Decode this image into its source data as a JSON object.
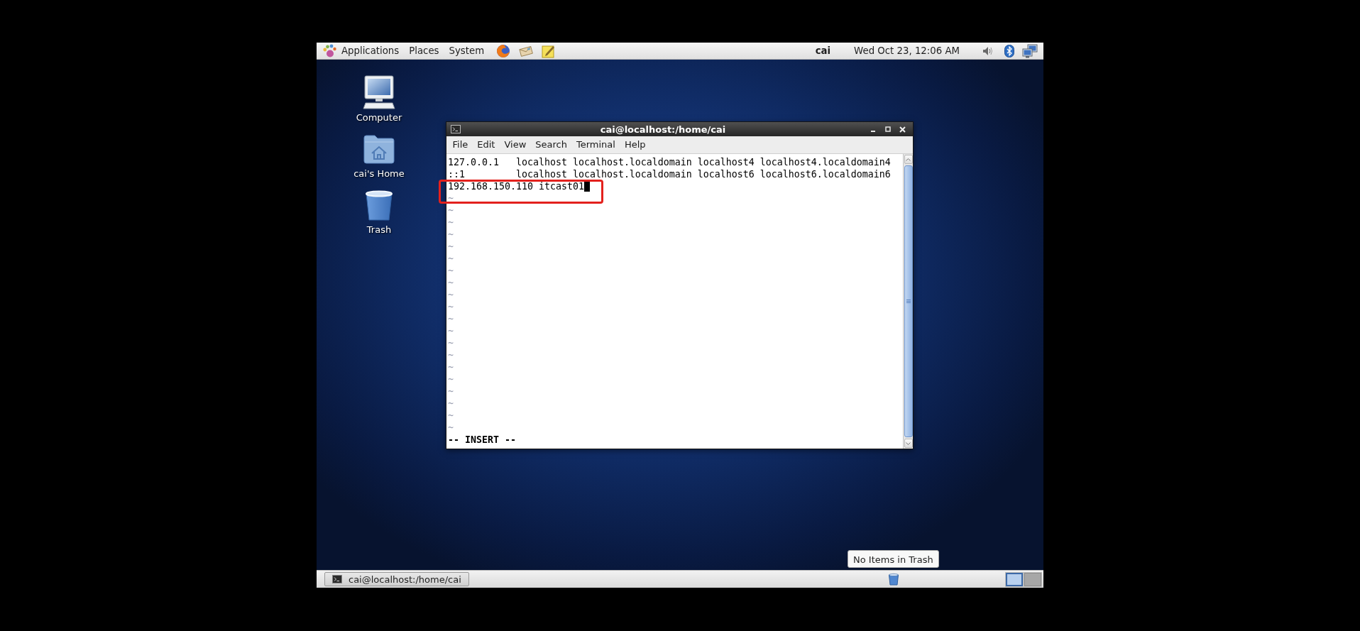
{
  "top_panel": {
    "menus": [
      "Applications",
      "Places",
      "System"
    ],
    "user": "cai",
    "clock": "Wed Oct 23, 12:06 AM"
  },
  "desktop_icons": [
    {
      "kind": "computer",
      "label": "Computer"
    },
    {
      "kind": "home",
      "label": "cai's Home"
    },
    {
      "kind": "trash",
      "label": "Trash"
    }
  ],
  "terminal": {
    "title": "cai@localhost:/home/cai",
    "menu": [
      "File",
      "Edit",
      "View",
      "Search",
      "Terminal",
      "Help"
    ],
    "lines": [
      {
        "text": "127.0.0.1   localhost localhost.localdomain localhost4 localhost4.localdomain4",
        "cursor": false,
        "highlighted": false
      },
      {
        "text": "::1         localhost localhost.localdomain localhost6 localhost6.localdomain6",
        "cursor": false,
        "highlighted": false
      },
      {
        "text": "192.168.150.110 itcast01",
        "cursor": true,
        "highlighted": true
      }
    ],
    "filler_rows": [
      "~",
      "~",
      "~",
      "~",
      "~",
      "~",
      "~",
      "~",
      "~",
      "~",
      "~",
      "~",
      "~",
      "~",
      "~",
      "~",
      "~",
      "~",
      "~",
      "~"
    ],
    "status_line": "-- INSERT --"
  },
  "tooltip": "No Items in Trash",
  "bottom_panel": {
    "tasks": [
      "cai@localhost:/home/cai"
    ],
    "workspaces": [
      {
        "selected": true
      },
      {
        "selected": false
      }
    ]
  }
}
